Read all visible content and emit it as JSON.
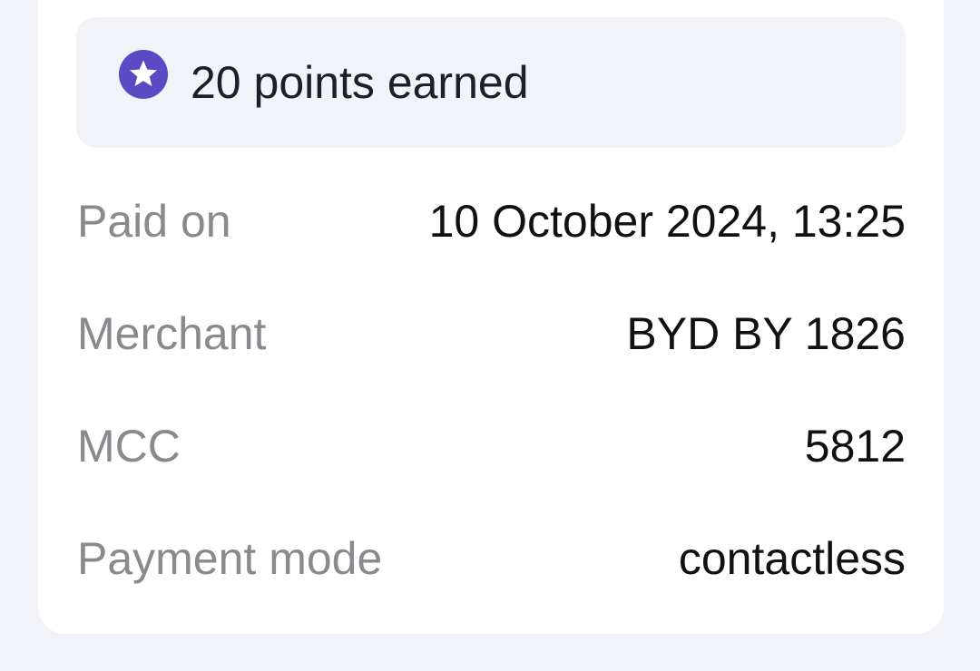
{
  "points": {
    "icon": "star-badge-icon",
    "text": "20 points earned",
    "accent_color": "#5b4ac4"
  },
  "details": [
    {
      "label": "Paid on",
      "value": "10 October 2024, 13:25"
    },
    {
      "label": "Merchant",
      "value": "BYD BY 1826"
    },
    {
      "label": "MCC",
      "value": "5812"
    },
    {
      "label": "Payment mode",
      "value": "contactless"
    }
  ]
}
